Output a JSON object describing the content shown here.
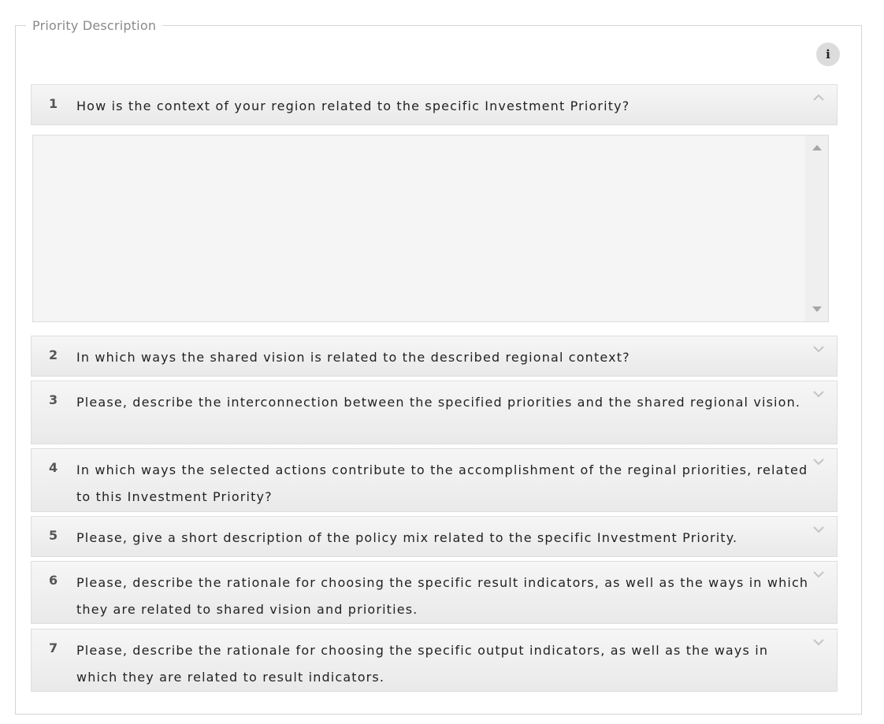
{
  "section": {
    "legend": "Priority Description",
    "info_icon": "i"
  },
  "questions": [
    {
      "number": "1",
      "text": "How is the context of your region related to the specific Investment Priority?",
      "expanded": true
    },
    {
      "number": "2",
      "text": "In which ways the shared vision is related to the described regional context?",
      "expanded": false
    },
    {
      "number": "3",
      "text": "Please, describe the interconnection between the specified priorities and the shared regional vision.",
      "expanded": false
    },
    {
      "number": "4",
      "text": "In which ways the selected actions contribute to the accomplishment of the reginal priorities, related to this Investment Priority?",
      "expanded": false
    },
    {
      "number": "5",
      "text": "Please, give a short description of the policy mix related to the specific Investment Priority.",
      "expanded": false
    },
    {
      "number": "6",
      "text": "Please, describe the rationale for choosing the specific result indicators, as well as the ways in which they are related to shared vision and priorities.",
      "expanded": false
    },
    {
      "number": "7",
      "text": "Please, describe the rationale for choosing the specific output indicators, as well as the ways in which they are related to result indicators.",
      "expanded": false
    }
  ],
  "answer_1": {
    "value": ""
  },
  "icons": {
    "info": "info-icon",
    "expanded": "chevron-up-icon",
    "collapsed": "chevron-down-icon",
    "scroll_up": "scroll-up-arrow-icon",
    "scroll_down": "scroll-down-arrow-icon"
  }
}
